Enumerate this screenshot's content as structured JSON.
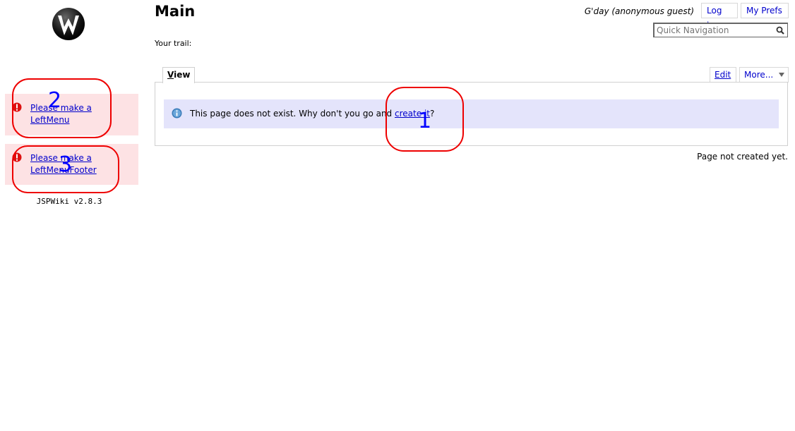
{
  "page": {
    "title": "Main",
    "trail_label": "Your trail:",
    "status": "Page not created yet."
  },
  "header": {
    "greeting": "G'day (anonymous guest)",
    "login_label": "Log in",
    "prefs_label": "My Prefs",
    "search_placeholder": "Quick Navigation"
  },
  "tabs": {
    "view_label": "View",
    "view_first": "V",
    "view_rest": "iew",
    "edit_label": "Edit",
    "more_label": "More..."
  },
  "info": {
    "text_before": "This page does not exist. Why don't you go and",
    "link_label": "create it",
    "text_after": "?"
  },
  "sidebar": {
    "left_menu_link": {
      "line1": "Please make a",
      "line2": "LeftMenu"
    },
    "left_menu_footer_link": {
      "line1": "Please make a",
      "line2": "LeftMenuFooter"
    },
    "version": "JSPWiki v2.8.3"
  },
  "annotations": [
    {
      "number": "1"
    },
    {
      "number": "2"
    },
    {
      "number": "3"
    }
  ],
  "icons": {
    "logo": "jspwiki-logo-icon",
    "error": "error-exclamation-icon",
    "info": "info-icon",
    "search": "magnifier-icon",
    "more_dropdown": "triangle-down-icon"
  },
  "colors": {
    "link": "#0000cc",
    "error_box_bg": "#fde2e4",
    "info_box_bg": "#e4e4fb",
    "annotation_circle": "#ee0000",
    "annotation_number": "#0000ff"
  }
}
